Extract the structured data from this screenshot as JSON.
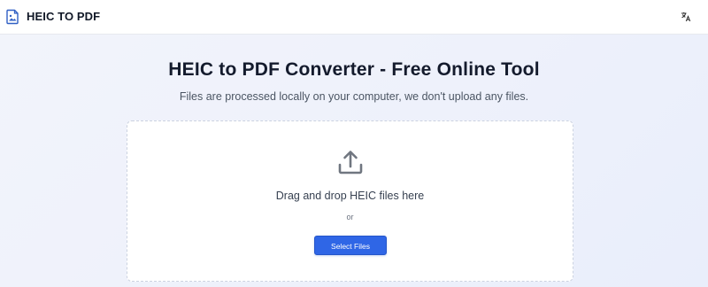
{
  "header": {
    "brand_title": "HEIC TO PDF",
    "brand_icon": "image-file-icon",
    "language_icon": "translate-icon"
  },
  "main": {
    "title": "HEIC to PDF Converter - Free Online Tool",
    "subtitle": "Files are processed locally on your computer, we don't upload any files."
  },
  "dropzone": {
    "icon": "upload-icon",
    "instruction": "Drag and drop HEIC files here",
    "or_label": "or",
    "select_button_label": "Select Files"
  },
  "colors": {
    "accent": "#2f66e6",
    "background": "#eef1fb",
    "dropzone_border": "#cbd2e0"
  }
}
